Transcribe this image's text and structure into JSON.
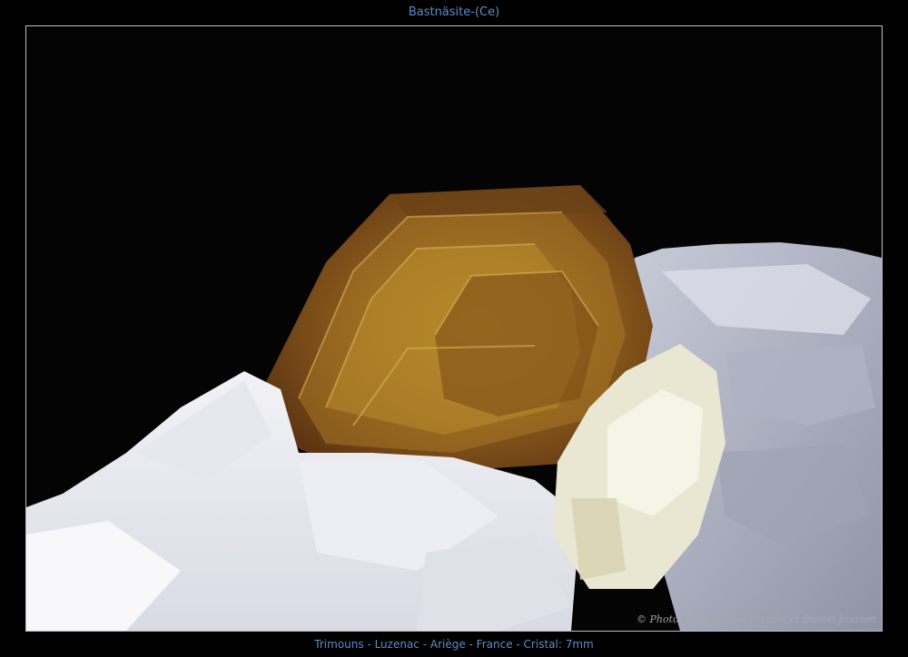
{
  "header": {
    "title": "Bastnäsite-(Ce)"
  },
  "photo": {
    "credit": "© Photo & Collection Pascale et Daniel Journet",
    "subject": "bastnasite-crystal-photo"
  },
  "footer": {
    "caption": "Trimouns - Luzenac - Ariège - France - Cristal: 7mm"
  }
}
